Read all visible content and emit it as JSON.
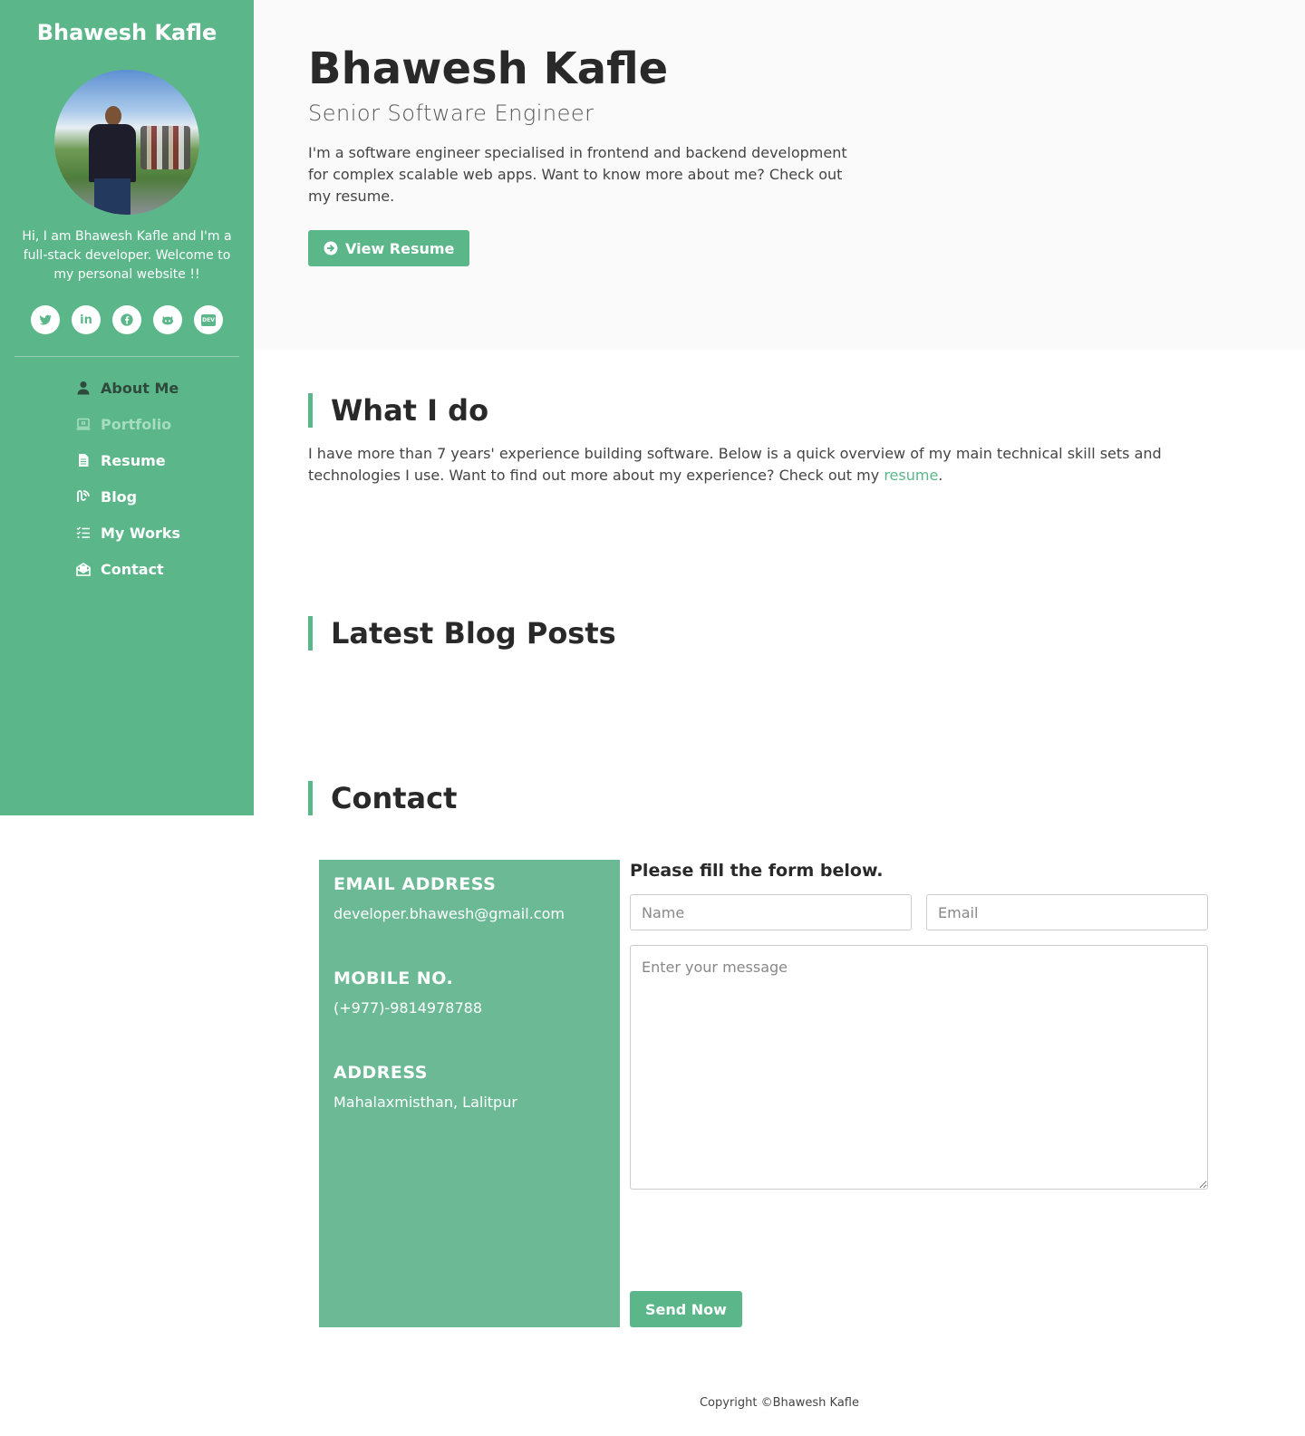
{
  "sidebar": {
    "name": "Bhawesh Kafle",
    "intro": "Hi, I am Bhawesh Kafle and I'm a full-stack developer. Welcome to my personal website !!",
    "socials": [
      {
        "name": "twitter",
        "icon": "twitter-icon"
      },
      {
        "name": "linkedin",
        "icon": "linkedin-icon",
        "glyph": "in"
      },
      {
        "name": "facebook",
        "icon": "facebook-icon"
      },
      {
        "name": "github",
        "icon": "github-icon"
      },
      {
        "name": "dev",
        "icon": "dev-icon",
        "glyph": "DEV"
      }
    ],
    "nav": [
      {
        "label": "About Me",
        "icon": "user-icon",
        "state": "active"
      },
      {
        "label": "Portfolio",
        "icon": "laptop-icon",
        "state": "muted"
      },
      {
        "label": "Resume",
        "icon": "file-icon",
        "state": "normal"
      },
      {
        "label": "Blog",
        "icon": "blog-icon",
        "state": "normal"
      },
      {
        "label": "My Works",
        "icon": "list-check-icon",
        "state": "normal"
      },
      {
        "label": "Contact",
        "icon": "envelope-open-icon",
        "state": "normal"
      }
    ]
  },
  "hero": {
    "name": "Bhawesh Kafle",
    "role": "Senior Software Engineer",
    "bio": "I'm a software engineer specialised in frontend and backend development for complex scalable web apps. Want to know more about me? Check out my resume.",
    "button_label": "View Resume",
    "button_icon": "arrow-circle-right-icon"
  },
  "what_i_do": {
    "title": "What I do",
    "text": "I have more than 7 years' experience building software. Below is a quick overview of my main technical skill sets and technologies I use. Want to find out more about my experience? Check out my",
    "link_text": "resume",
    "text_end": "."
  },
  "blog": {
    "title": "Latest Blog Posts"
  },
  "contact": {
    "title": "Contact",
    "email_label": "EMAIL ADDRESS",
    "email_value": "developer.bhawesh@gmail.com",
    "mobile_label": "MOBILE NO.",
    "mobile_value": "(+977)-9814978788",
    "address_label": "ADDRESS",
    "address_value": "Mahalaxmisthan, Lalitpur",
    "form_heading": "Please fill the form below.",
    "name_placeholder": "Name",
    "email_placeholder": "Email",
    "message_placeholder": "Enter your message",
    "submit_label": "Send Now"
  },
  "footer": {
    "copyright": "Copyright ©Bhawesh Kafle"
  },
  "colors": {
    "accent": "#5bb78a",
    "info_box": "#6cba95",
    "hero_bg": "#fafafa",
    "heading": "#292929"
  }
}
